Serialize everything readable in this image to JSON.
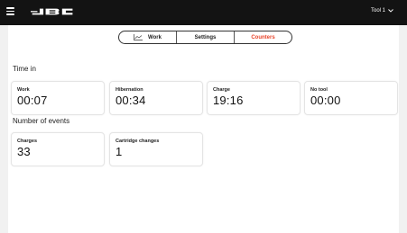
{
  "header": {
    "brand": "JBC",
    "tool_selector": "Tool 1"
  },
  "tabs": [
    {
      "label": "Work",
      "active": false
    },
    {
      "label": "Settings",
      "active": false
    },
    {
      "label": "Counters",
      "active": true
    }
  ],
  "time_in": {
    "title": "Time in",
    "cards": [
      {
        "label": "Work",
        "value": "00:07"
      },
      {
        "label": "Hibernation",
        "value": "00:34"
      },
      {
        "label": "Charge",
        "value": "19:16"
      },
      {
        "label": "No tool",
        "value": "00:00"
      }
    ]
  },
  "events": {
    "title": "Number of events",
    "cards": [
      {
        "label": "Charges",
        "value": "33"
      },
      {
        "label": "Cartridge changes",
        "value": "1"
      }
    ]
  },
  "colors": {
    "accent": "#e8452b",
    "topbar": "#131313",
    "background": "#f1f1f1"
  }
}
